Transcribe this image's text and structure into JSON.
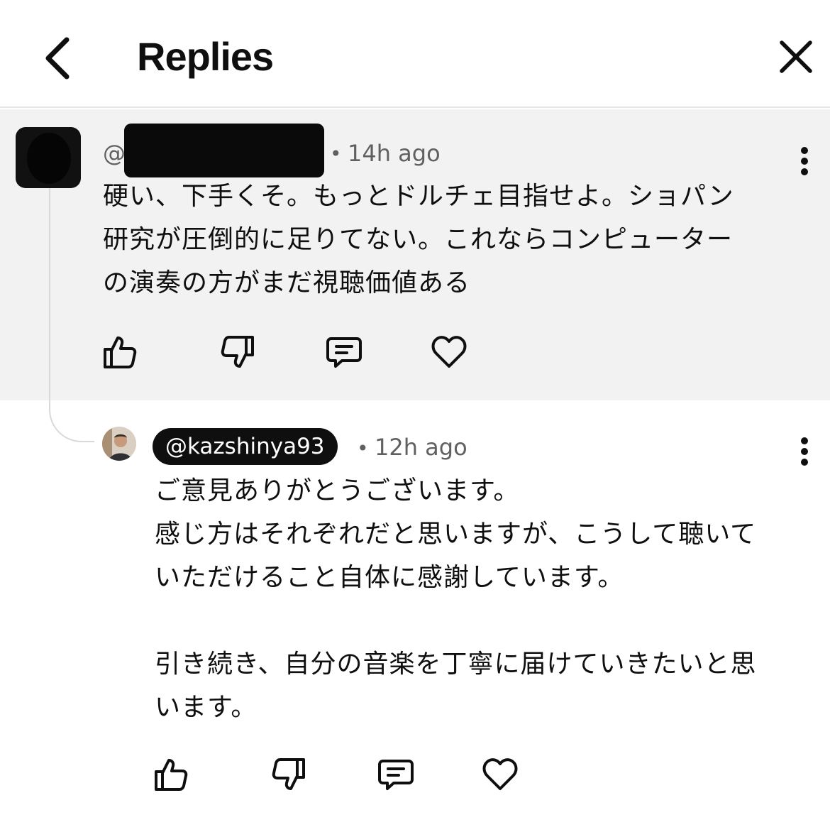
{
  "header": {
    "title": "Replies",
    "back_icon": "chevron-left-icon",
    "close_icon": "close-icon"
  },
  "parent_comment": {
    "handle_prefix": "@",
    "time": "14h ago",
    "separator": "•",
    "lines": [
      "硬い、下手くそ。もっとドルチェ目指せよ。ショパン",
      "研究が圧倒的に足りてない。これならコンピューター",
      "の演奏の方がまだ視聴価値ある"
    ],
    "actions": [
      "like-icon",
      "dislike-icon",
      "reply-icon",
      "heart-icon"
    ]
  },
  "reply": {
    "author": "@kazshinya93",
    "separator": "•",
    "time": "12h ago",
    "lines": [
      "ご意見ありがとうございます。",
      "感じ方はそれぞれだと思いますが、こうして聴いて",
      "いただけること自体に感謝しています。",
      "",
      "引き続き、自分の音楽を丁寧に届けていきたいと思",
      "います。"
    ],
    "actions": [
      "like-icon",
      "dislike-icon",
      "reply-icon",
      "heart-icon"
    ]
  },
  "colors": {
    "parent_background": "#f2f2f2",
    "text": "#0f0f0f",
    "secondary_text": "#606060",
    "author_badge": "#0f0f0f"
  }
}
